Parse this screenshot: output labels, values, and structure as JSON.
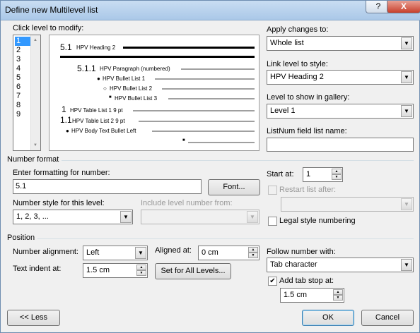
{
  "window": {
    "title": "Define new Multilevel list",
    "help_glyph": "?",
    "close_glyph": "X"
  },
  "level_list": {
    "label": "Click level to modify:",
    "items": [
      "1",
      "2",
      "3",
      "4",
      "5",
      "6",
      "7",
      "8",
      "9"
    ],
    "selected": "1"
  },
  "preview": {
    "lines": [
      {
        "num": "5.1",
        "text": "HPV Heading 2"
      },
      {
        "num": "5.1.1",
        "text": "HPV Paragraph (numbered)"
      },
      {
        "num": "●",
        "text": "HPV Bullet List 1"
      },
      {
        "num": "○",
        "text": "HPV Bullet List 2"
      },
      {
        "num": "■",
        "text": "HPV Bullet List 3"
      },
      {
        "num": "1",
        "text": "HPV Table List 1 9 pt"
      },
      {
        "num": "1.1",
        "text": "HPV Table List 2 9 pt"
      },
      {
        "num": "●",
        "text": "HPV Body Text Bullet Left"
      },
      {
        "num": "■",
        "text": ""
      }
    ]
  },
  "apply": {
    "label": "Apply changes to:",
    "value": "Whole list"
  },
  "link": {
    "label": "Link level to style:",
    "value": "HPV Heading 2"
  },
  "gallery": {
    "label": "Level to show in gallery:",
    "value": "Level 1"
  },
  "listnum": {
    "label": "ListNum field list name:",
    "value": ""
  },
  "number_format": {
    "group_label": "Number format",
    "enter_label": "Enter formatting for number:",
    "value": "5.1",
    "font_button": "Font...",
    "style_label": "Number style for this level:",
    "style_value": "1, 2, 3, ...",
    "include_label": "Include level number from:",
    "include_value": "",
    "start_label": "Start at:",
    "start_value": "1",
    "restart_label": "Restart list after:",
    "restart_checked": false,
    "restart_value": "",
    "legal_label": "Legal style numbering",
    "legal_checked": false
  },
  "position": {
    "group_label": "Position",
    "align_label": "Number alignment:",
    "align_value": "Left",
    "aligned_at_label": "Aligned at:",
    "aligned_at_value": "0 cm",
    "indent_label": "Text indent at:",
    "indent_value": "1.5 cm",
    "set_all_button": "Set for All Levels...",
    "follow_label": "Follow number with:",
    "follow_value": "Tab character",
    "tab_stop_label": "Add tab stop at:",
    "tab_stop_checked": true,
    "tab_stop_value": "1.5 cm"
  },
  "buttons": {
    "less": "<< Less",
    "ok": "OK",
    "cancel": "Cancel"
  }
}
